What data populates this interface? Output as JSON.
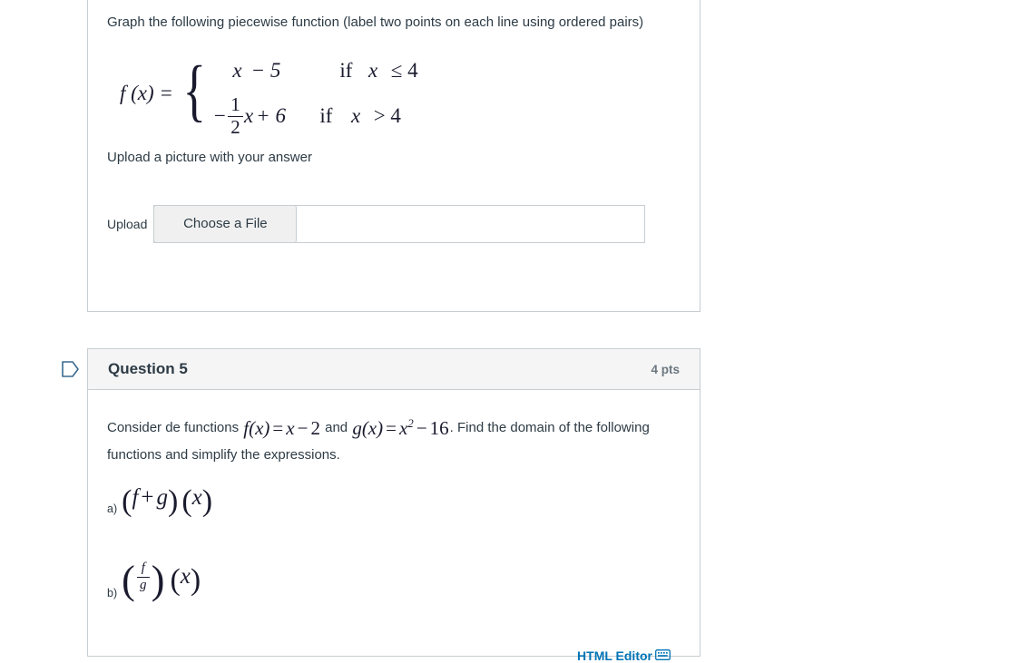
{
  "question_4": {
    "prompt": "Graph the following piecewise function (label two points on each line using ordered pairs)",
    "equation": {
      "lhs": "f (x) =",
      "rows": [
        {
          "expression": "x  − 5",
          "condition": "if x ≤ 4"
        },
        {
          "expression": "−(1/2)x + 6",
          "condition": "if  x > 4"
        }
      ],
      "row1_var": "x",
      "row1_rest": "− 5",
      "row1_cond_if": "if",
      "row1_cond_var": "x",
      "row1_cond_rel": "≤ 4",
      "row2_minus": "−",
      "row2_num": "1",
      "row2_den": "2",
      "row2_var": "x",
      "row2_rest": "+ 6",
      "row2_cond_if": "if",
      "row2_cond_var": "x",
      "row2_cond_rel": "> 4"
    },
    "upload_prompt": "Upload a picture with your answer",
    "upload_label": "Upload",
    "choose_file_button": "Choose a File",
    "file_name_value": ""
  },
  "question_5": {
    "title": "Question 5",
    "points": "4 pts",
    "flag_icon": "bookmark-flag-icon",
    "para_prefix": "Consider de functions ",
    "math_f_fn": "f",
    "math_f_arg": "(x)",
    "math_f_eq": "=",
    "math_f_rhs_var": "x",
    "math_f_rhs_op": "−",
    "math_f_rhs_num": "2",
    "para_and": " and ",
    "math_g_fn": "g",
    "math_g_arg": "(x)",
    "math_g_eq": "=",
    "math_g_rhs_var": "x",
    "math_g_rhs_exp": "2",
    "math_g_rhs_op": "−",
    "math_g_rhs_num": "16",
    "para_suffix": ". Find the domain of the following functions and simplify the expressions.",
    "part_a_label": "a)",
    "part_a_open": "(",
    "part_a_f": "f",
    "part_a_plus": "+",
    "part_a_g": "g",
    "part_a_close": ")",
    "part_a_arg_open": "(",
    "part_a_arg": "x",
    "part_a_arg_close": ")",
    "part_b_label": "b)",
    "part_b_open": "(",
    "part_b_num": "f",
    "part_b_den": "g",
    "part_b_close": ")",
    "part_b_arg_open": "(",
    "part_b_arg": "x",
    "part_b_arg_close": ")",
    "html_editor_link": "HTML Editor",
    "html_editor_icon": "keyboard-icon"
  },
  "colors": {
    "text": "#2d3b45",
    "muted": "#6b7780",
    "border": "#c7cdd1",
    "header_bg": "#f5f5f5",
    "link": "#0374b5",
    "flag": "#3a6a8f"
  }
}
